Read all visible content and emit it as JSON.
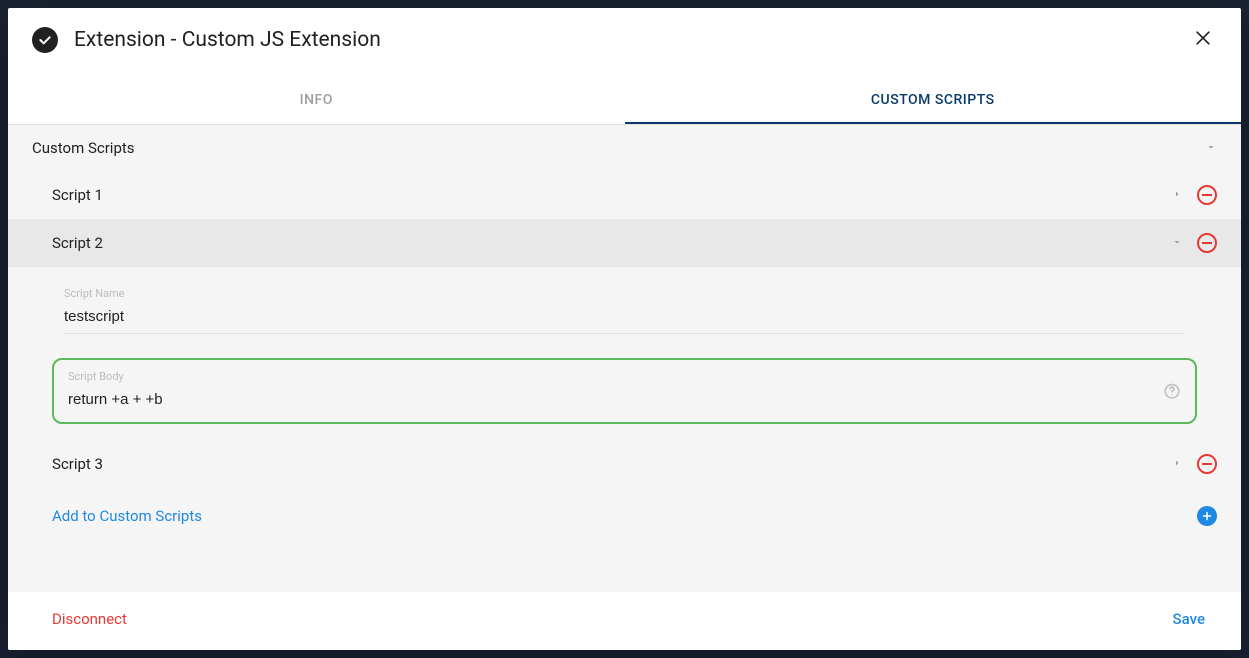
{
  "header": {
    "title": "Extension - Custom JS Extension"
  },
  "tabs": {
    "info": "INFO",
    "customScripts": "CUSTOM SCRIPTS"
  },
  "section": {
    "title": "Custom Scripts"
  },
  "scripts": {
    "s1": {
      "label": "Script 1"
    },
    "s2": {
      "label": "Script 2",
      "nameLabel": "Script Name",
      "nameValue": "testscript",
      "bodyLabel": "Script Body",
      "bodyValue": "return +a + +b"
    },
    "s3": {
      "label": "Script 3"
    }
  },
  "actions": {
    "addLabel": "Add to Custom Scripts",
    "disconnect": "Disconnect",
    "save": "Save"
  }
}
